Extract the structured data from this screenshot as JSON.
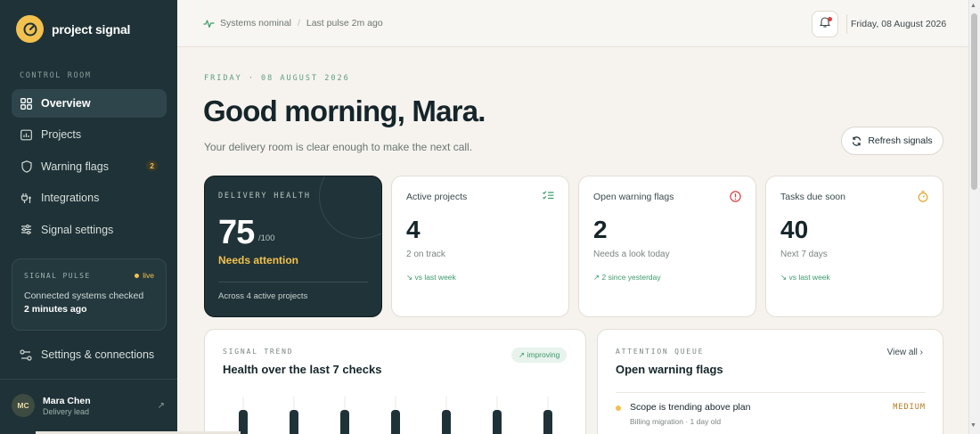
{
  "sidebar": {
    "brand_name": "project signal",
    "section_label": "CONTROL ROOM",
    "items": [
      {
        "label": "Overview",
        "icon": "grid-icon",
        "active": true
      },
      {
        "label": "Projects",
        "icon": "folder-chart-icon"
      },
      {
        "label": "Warning flags",
        "icon": "shield-icon",
        "badge": "2"
      },
      {
        "label": "Integrations",
        "icon": "plug-icon"
      },
      {
        "label": "Signal settings",
        "icon": "sliders-icon"
      }
    ],
    "pulse": {
      "title": "SIGNAL PULSE",
      "live": "live",
      "text": "Connected systems checked",
      "time": "2 minutes ago"
    },
    "settings_label": "Settings & connections",
    "user": {
      "initials": "MC",
      "name": "Mara Chen",
      "role": "Delivery lead"
    }
  },
  "topbar": {
    "status": "Systems nominal",
    "separator": "/",
    "last_pulse": "Last pulse 2m ago",
    "date": "Friday, 08 August 2026"
  },
  "main": {
    "eyebrow": "FRIDAY · 08 AUGUST 2026",
    "greeting": "Good morning, Mara.",
    "subline": "Your delivery room is clear enough to make the next call.",
    "refresh_label": "Refresh signals"
  },
  "health": {
    "label": "DELIVERY HEALTH",
    "score": "75",
    "max": "/100",
    "status": "Needs attention",
    "footer": "Across 4 active projects"
  },
  "cards": [
    {
      "title": "Active projects",
      "value": "4",
      "sub": "2 on track",
      "trend": "↘ vs last week",
      "icon": "checklist-icon",
      "icon_color": "#3f9a6c"
    },
    {
      "title": "Open warning flags",
      "value": "2",
      "sub": "Needs a look today",
      "trend": "↗ 2 since yesterday",
      "icon": "alert-circle-icon",
      "icon_color": "#d94040"
    },
    {
      "title": "Tasks due soon",
      "value": "40",
      "sub": "Next 7 days",
      "trend": "↘ vs last week",
      "icon": "timer-icon",
      "icon_color": "#e3a52b"
    }
  ],
  "trend_panel": {
    "eyebrow": "SIGNAL TREND",
    "title": "Health over the last 7 checks",
    "chip": "↗ improving"
  },
  "queue_panel": {
    "eyebrow": "ATTENTION QUEUE",
    "title": "Open warning flags",
    "view_all": "View all ›",
    "items": [
      {
        "title": "Scope is trending above plan",
        "meta": "Billing migration · 1 day old",
        "severity": "MEDIUM"
      }
    ]
  },
  "colors": {
    "sidebar": "#1f3237",
    "accent": "#f2c14e",
    "positive": "#3f9a6c",
    "danger": "#d94040"
  }
}
